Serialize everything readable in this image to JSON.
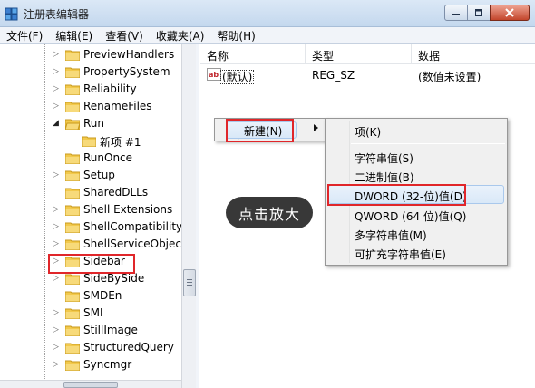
{
  "window": {
    "title": "注册表编辑器"
  },
  "menubar": {
    "items": [
      "文件(F)",
      "编辑(E)",
      "查看(V)",
      "收藏夹(A)",
      "帮助(H)"
    ]
  },
  "tree": {
    "items": [
      {
        "label": "PreviewHandlers",
        "expand": "▷"
      },
      {
        "label": "PropertySystem",
        "expand": "▷"
      },
      {
        "label": "Reliability",
        "expand": "▷"
      },
      {
        "label": "RenameFiles",
        "expand": "▷"
      },
      {
        "label": "Run",
        "expand": "◢"
      },
      {
        "label": "新项 #1",
        "expand": ""
      },
      {
        "label": "RunOnce",
        "expand": ""
      },
      {
        "label": "Setup",
        "expand": "▷"
      },
      {
        "label": "SharedDLLs",
        "expand": ""
      },
      {
        "label": "Shell Extensions",
        "expand": "▷"
      },
      {
        "label": "ShellCompatibility",
        "expand": "▷"
      },
      {
        "label": "ShellServiceObjectD",
        "expand": "▷"
      },
      {
        "label": "Sidebar",
        "expand": "▷"
      },
      {
        "label": "SideBySide",
        "expand": "▷"
      },
      {
        "label": "SMDEn",
        "expand": ""
      },
      {
        "label": "SMI",
        "expand": "▷"
      },
      {
        "label": "StillImage",
        "expand": "▷"
      },
      {
        "label": "StructuredQuery",
        "expand": "▷"
      },
      {
        "label": "Syncmgr",
        "expand": "▷"
      }
    ]
  },
  "list": {
    "columns": [
      "名称",
      "类型",
      "数据"
    ],
    "rows": [
      {
        "name": "(默认)",
        "type": "REG_SZ",
        "data": "(数值未设置)"
      }
    ]
  },
  "context_menu": {
    "new_label": "新建(N)",
    "submenu": {
      "items": [
        "项(K)",
        "字符串值(S)",
        "二进制值(B)",
        "DWORD (32-位)值(D)",
        "QWORD (64 位)值(Q)",
        "多字符串值(M)",
        "可扩充字符串值(E)"
      ]
    }
  },
  "overlay": {
    "zoom_hint": "点击放大"
  },
  "colors": {
    "highlight_red": "#e0262a",
    "folder_yellow": "#f2c94c"
  }
}
